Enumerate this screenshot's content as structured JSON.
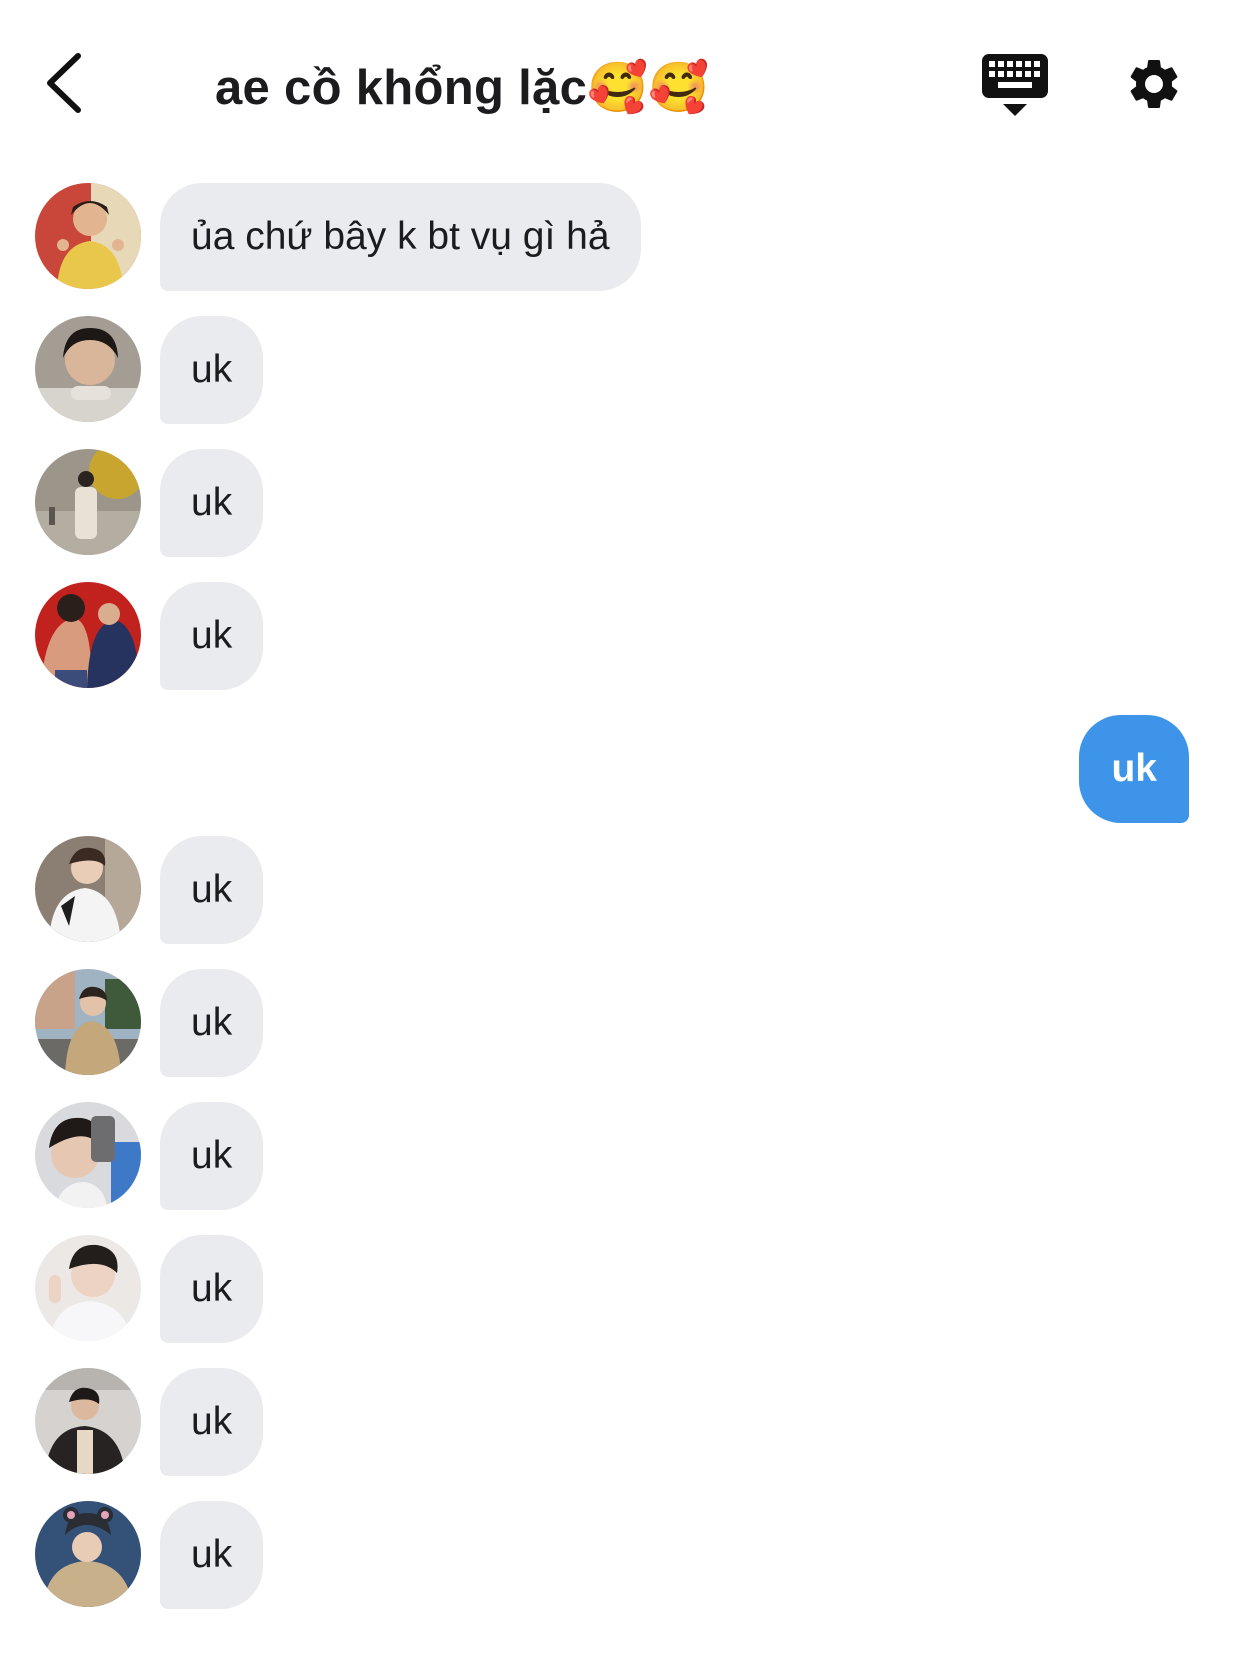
{
  "header": {
    "title": "ae cồ khổng lặc🥰🥰",
    "back_icon": "chevron-left-icon",
    "keyboard_icon": "keyboard-hide-icon",
    "settings_icon": "gear-icon"
  },
  "colors": {
    "incoming_bubble": "#e9ebef",
    "outgoing_bubble": "#3d94e9",
    "text": "#1c1c1e"
  },
  "messages": [
    {
      "direction": "incoming",
      "text": "ủa chứ bây k bt vụ gì hả"
    },
    {
      "direction": "incoming",
      "text": "uk"
    },
    {
      "direction": "incoming",
      "text": "uk"
    },
    {
      "direction": "incoming",
      "text": "uk"
    },
    {
      "direction": "outgoing",
      "text": "uk"
    },
    {
      "direction": "incoming",
      "text": "uk"
    },
    {
      "direction": "incoming",
      "text": "uk"
    },
    {
      "direction": "incoming",
      "text": "uk"
    },
    {
      "direction": "incoming",
      "text": "uk"
    },
    {
      "direction": "incoming",
      "text": "uk"
    },
    {
      "direction": "incoming",
      "text": "uk"
    }
  ]
}
